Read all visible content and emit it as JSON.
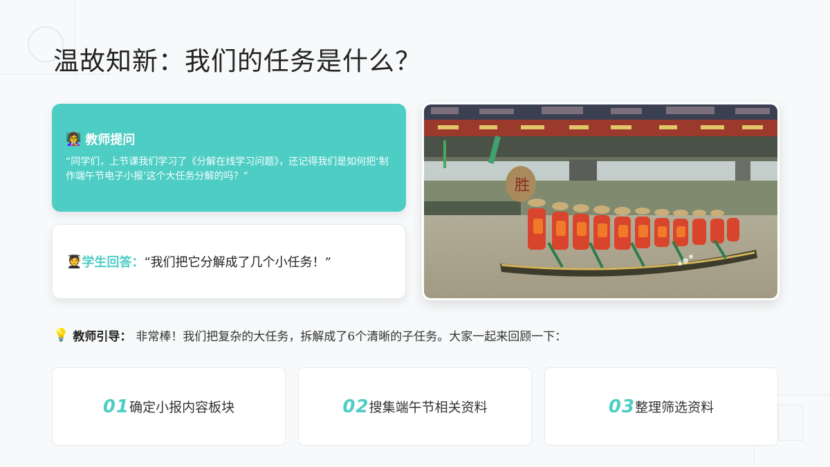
{
  "title": "温故知新：我们的任务是什么？",
  "teacher": {
    "icon": "teacher-emoji-icon",
    "heading": "教师提问",
    "text": "“同学们，上节课我们学习了《分解在线学习问题》，还记得我们是如何把‘制作端午节电子小报’这个大任务分解的吗？”"
  },
  "student": {
    "icon": "student-emoji-icon",
    "label": "学生回答：",
    "text": "“我们把它分解成了几个小任务！”"
  },
  "photo": {
    "subject": "dragon-boat-race-photo",
    "drum_glyph": "胜"
  },
  "guide": {
    "icon": "lightbulb-icon",
    "label": "教师引导：",
    "text": "非常棒！我们把复杂的大任务，拆解成了6个清晰的子任务。大家一起来回顾一下："
  },
  "tasks": [
    {
      "num": "01",
      "label": "确定小报内容板块"
    },
    {
      "num": "02",
      "label": "搜集端午节相关资料"
    },
    {
      "num": "03",
      "label": "整理筛选资料"
    }
  ],
  "colors": {
    "accent": "#4ecdc4",
    "background": "#f7f9fa",
    "text": "#222222"
  }
}
